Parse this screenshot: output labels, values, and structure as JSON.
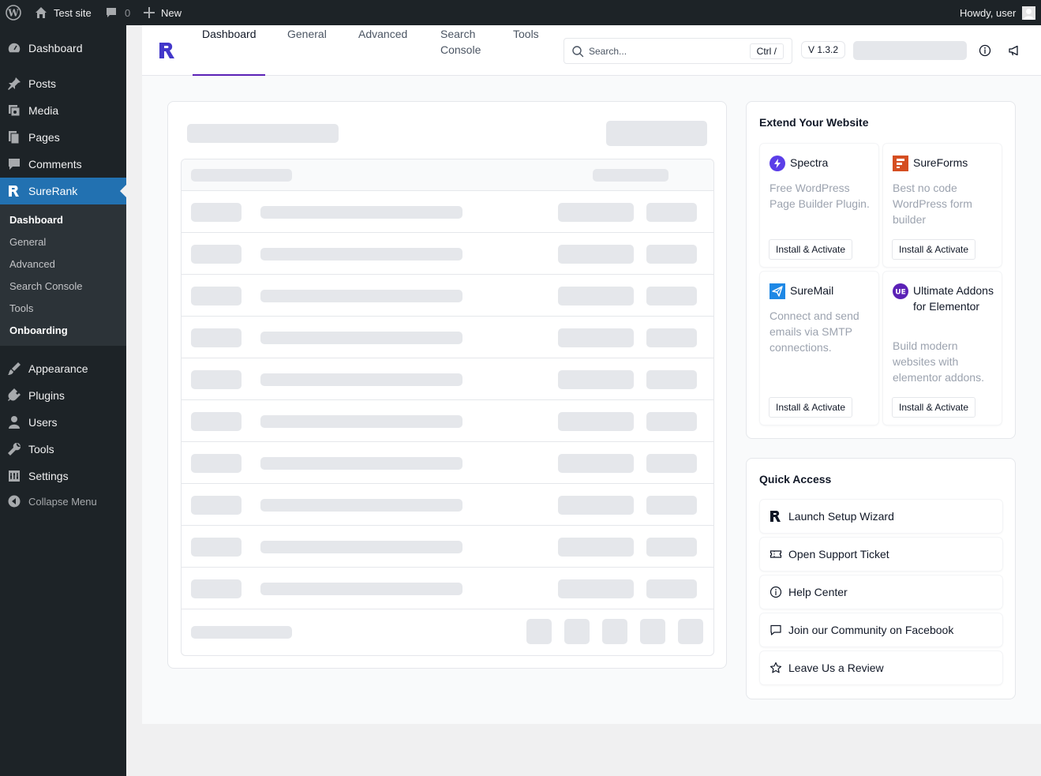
{
  "adminbar": {
    "site_name": "Test site",
    "comments_count": "0",
    "new_label": "New",
    "howdy": "Howdy, user"
  },
  "sidebar": {
    "items": [
      {
        "label": "Dashboard",
        "icon": "dashboard-icon"
      },
      {
        "label": "Posts",
        "icon": "pin-icon"
      },
      {
        "label": "Media",
        "icon": "media-icon"
      },
      {
        "label": "Pages",
        "icon": "pages-icon"
      },
      {
        "label": "Comments",
        "icon": "comment-icon"
      },
      {
        "label": "SureRank",
        "icon": "surerank-icon"
      },
      {
        "label": "Appearance",
        "icon": "brush-icon"
      },
      {
        "label": "Plugins",
        "icon": "plug-icon"
      },
      {
        "label": "Users",
        "icon": "user-icon"
      },
      {
        "label": "Tools",
        "icon": "wrench-icon"
      },
      {
        "label": "Settings",
        "icon": "settings-icon"
      }
    ],
    "submenu": [
      "Dashboard",
      "General",
      "Advanced",
      "Search Console",
      "Tools",
      "Onboarding"
    ],
    "collapse_label": "Collapse Menu"
  },
  "topnav": {
    "tabs": [
      {
        "label": "Dashboard",
        "active": true
      },
      {
        "label": "General"
      },
      {
        "label": "Advanced"
      },
      {
        "label": "Search\nConsole"
      },
      {
        "label": "Tools"
      }
    ],
    "search_placeholder": "Search...",
    "shortcut": "Ctrl /",
    "version": "V 1.3.2"
  },
  "extend": {
    "title": "Extend Your Website",
    "plugins": [
      {
        "name": "Spectra",
        "desc": "Free WordPress Page Builder Plugin.",
        "button": "Install & Activate",
        "color": "#5b3ee8"
      },
      {
        "name": "SureForms",
        "desc": "Best no code WordPress form builder",
        "button": "Install & Activate",
        "color": "#d54e21"
      },
      {
        "name": "SureMail",
        "desc": "Connect and send emails via SMTP connections.",
        "button": "Install & Activate",
        "color": "#1e88e5"
      },
      {
        "name": "Ultimate Addons for Elementor",
        "desc": "Build modern websites with elementor addons.",
        "button": "Install & Activate",
        "color": "#5b21b6"
      }
    ]
  },
  "quick_access": {
    "title": "Quick Access",
    "items": [
      {
        "label": "Launch Setup Wizard",
        "icon": "surerank-icon"
      },
      {
        "label": "Open Support Ticket",
        "icon": "ticket-icon"
      },
      {
        "label": "Help Center",
        "icon": "info-icon"
      },
      {
        "label": "Join our Community on Facebook",
        "icon": "message-icon"
      },
      {
        "label": "Leave Us a Review",
        "icon": "star-icon"
      }
    ]
  },
  "colors": {
    "accent": "#5b21b6",
    "wp_blue": "#2271b1",
    "admin_dark": "#1d2327"
  }
}
